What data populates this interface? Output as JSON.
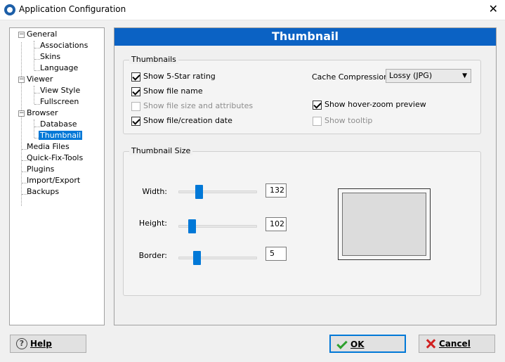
{
  "window": {
    "title": "Application Configuration"
  },
  "tree": {
    "items": [
      {
        "label": "General"
      },
      {
        "label": "Associations"
      },
      {
        "label": "Skins"
      },
      {
        "label": "Language"
      },
      {
        "label": "Viewer"
      },
      {
        "label": "View Style"
      },
      {
        "label": "Fullscreen"
      },
      {
        "label": "Browser"
      },
      {
        "label": "Database"
      },
      {
        "label": "Thumbnail"
      },
      {
        "label": "Media Files"
      },
      {
        "label": "Quick-Fix-Tools"
      },
      {
        "label": "Plugins"
      },
      {
        "label": "Import/Export"
      },
      {
        "label": "Backups"
      }
    ],
    "selected": "Thumbnail"
  },
  "header": {
    "title": "Thumbnail",
    "color": "#0b62c4"
  },
  "thumbnails_group": {
    "title": "Thumbnails",
    "options": [
      {
        "label": "Show 5-Star rating",
        "checked": true,
        "enabled": true
      },
      {
        "label": "Show file name",
        "checked": true,
        "enabled": true
      },
      {
        "label": "Show file size and attributes",
        "checked": false,
        "enabled": false
      },
      {
        "label": "Show file/creation date",
        "checked": true,
        "enabled": true
      },
      {
        "label": "Show hover-zoom preview",
        "checked": true,
        "enabled": true
      },
      {
        "label": "Show tooltip",
        "checked": false,
        "enabled": false
      }
    ],
    "cache_compression": {
      "label": "Cache Compression:",
      "value": "Lossy (JPG)"
    }
  },
  "size_group": {
    "title": "Thumbnail Size",
    "width": {
      "label": "Width:",
      "value": "132"
    },
    "height": {
      "label": "Height:",
      "value": "102"
    },
    "border": {
      "label": "Border:",
      "value": "5"
    }
  },
  "buttons": {
    "help": "Help",
    "ok": "OK",
    "cancel": "Cancel"
  },
  "colors": {
    "accent": "#0078d7"
  }
}
